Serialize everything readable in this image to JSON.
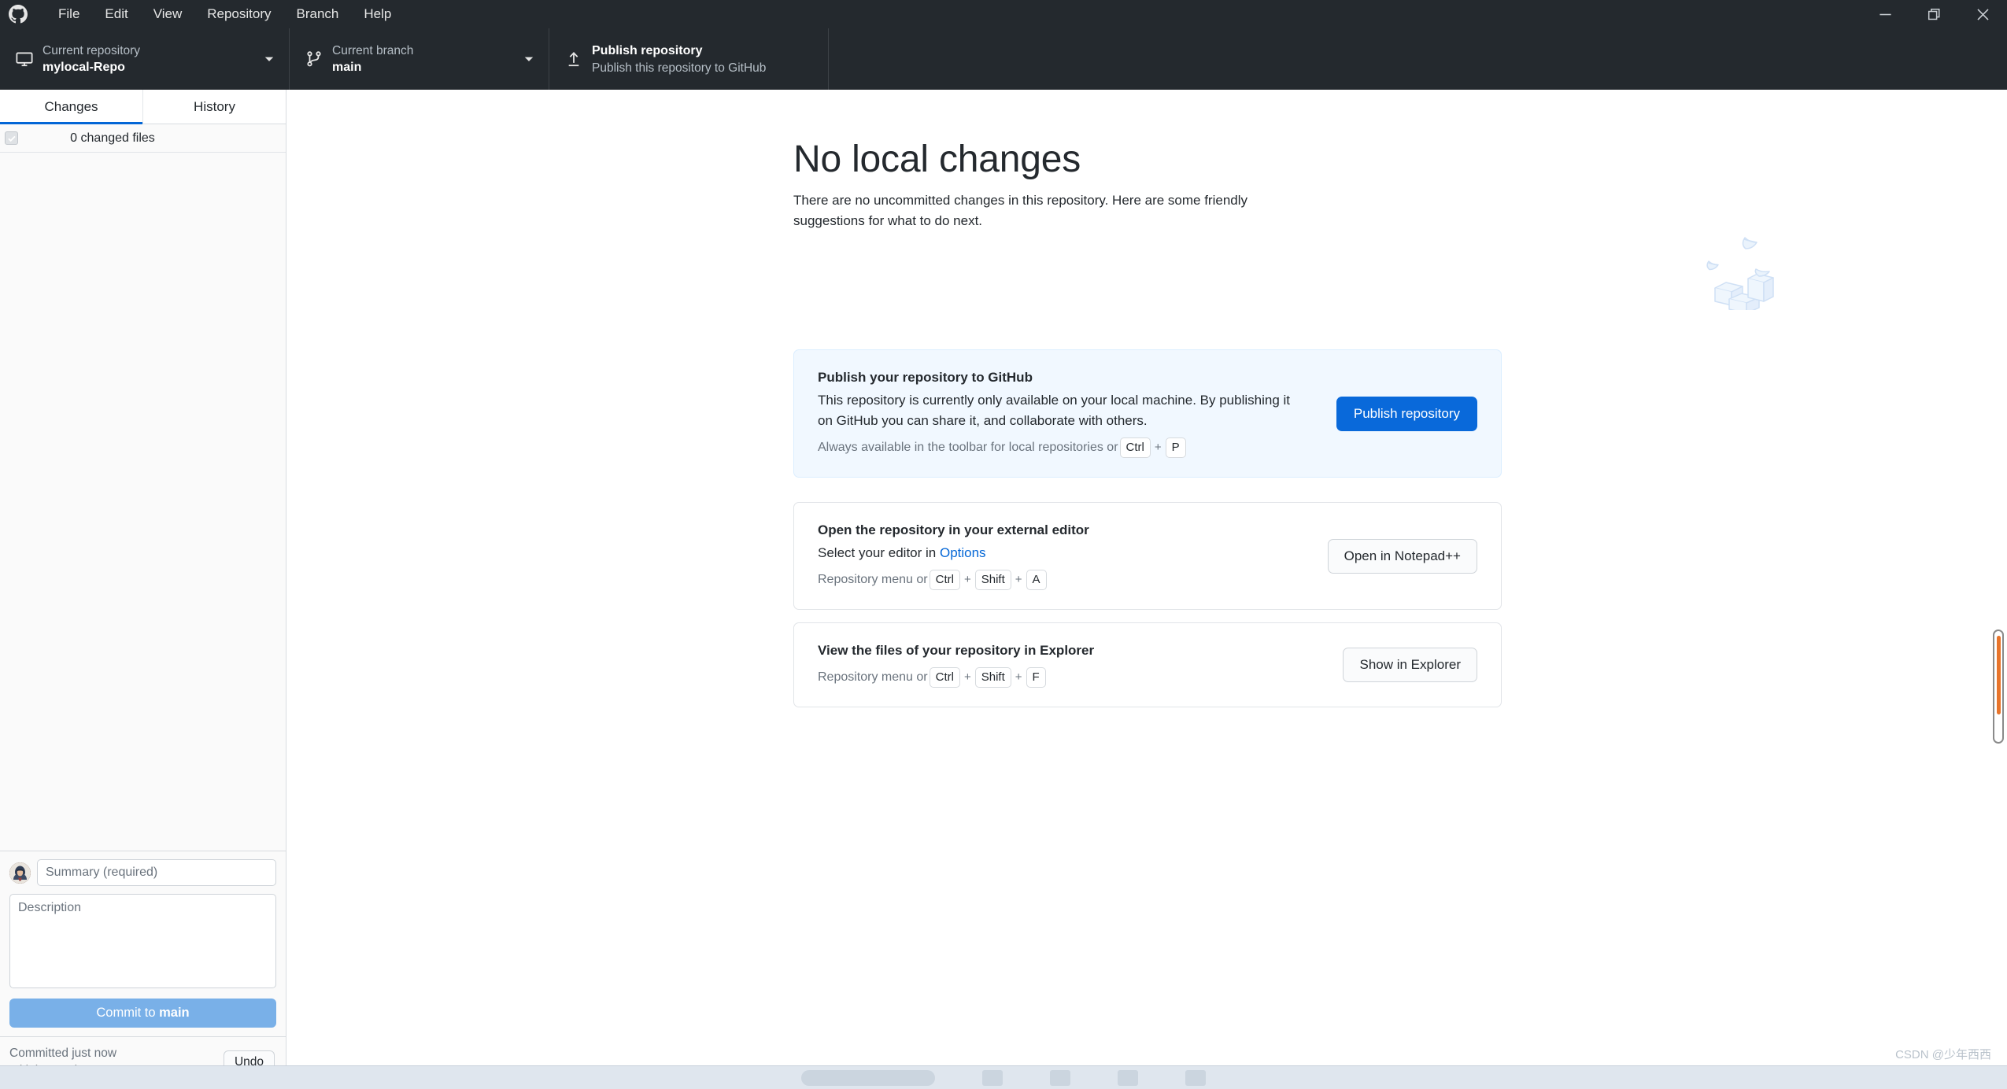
{
  "window": {
    "app_icon": "github-logo-icon",
    "minimize_label": "Minimize",
    "maximize_label": "Restore",
    "close_label": "Close"
  },
  "menubar": {
    "items": [
      {
        "label": "File"
      },
      {
        "label": "Edit"
      },
      {
        "label": "View"
      },
      {
        "label": "Repository"
      },
      {
        "label": "Branch"
      },
      {
        "label": "Help"
      }
    ]
  },
  "toolbar": {
    "repository": {
      "icon": "desktop-monitor-icon",
      "label": "Current repository",
      "value": "mylocal-Repo",
      "caret": "chevron-down-icon"
    },
    "branch": {
      "icon": "git-branch-icon",
      "label": "Current branch",
      "value": "main",
      "caret": "chevron-down-icon"
    },
    "publish": {
      "icon": "upload-arrow-icon",
      "title": "Publish repository",
      "subtitle": "Publish this repository to GitHub"
    }
  },
  "sidebar": {
    "tabs": [
      {
        "label": "Changes",
        "active": true
      },
      {
        "label": "History",
        "active": false
      }
    ],
    "changed_files": {
      "checkbox_state": "checked-disabled",
      "label": "0 changed files"
    },
    "commit": {
      "avatar": "user-avatar",
      "summary_placeholder": "Summary (required)",
      "summary_value": "",
      "description_placeholder": "Description",
      "description_value": "",
      "commit_button_prefix": "Commit to ",
      "commit_button_branch": "main"
    },
    "undo": {
      "status": "Committed just now",
      "commit_message": "Initial commit",
      "button_label": "Undo"
    }
  },
  "main": {
    "title": "No local changes",
    "description": "There are no uncommitted changes in this repository. Here are some friendly suggestions for what to do next.",
    "illustration": "paper-boats-and-boxes-illustration",
    "cards": [
      {
        "highlight": true,
        "title": "Publish your repository to GitHub",
        "description": "This repository is currently only available on your local machine. By publishing it on GitHub you can share it, and collaborate with others.",
        "hint_prefix": "Always available in the toolbar for local repositories or ",
        "keys": [
          "Ctrl",
          "P"
        ],
        "button_label": "Publish repository",
        "button_style": "primary"
      },
      {
        "highlight": false,
        "title": "Open the repository in your external editor",
        "description_prefix": "Select your editor in ",
        "description_link": "Options",
        "hint_prefix": "Repository menu or ",
        "keys": [
          "Ctrl",
          "Shift",
          "A"
        ],
        "button_label": "Open in Notepad++",
        "button_style": "default"
      },
      {
        "highlight": false,
        "title": "View the files of your repository in Explorer",
        "hint_prefix": "Repository menu or ",
        "keys": [
          "Ctrl",
          "Shift",
          "F"
        ],
        "button_label": "Show in Explorer",
        "button_style": "default"
      }
    ]
  },
  "scrollbar": {
    "orientation": "vertical",
    "thumb_color": "#e8742b"
  },
  "watermark": {
    "text": "CSDN @少年西西"
  },
  "colors": {
    "titlebar_bg": "#24292e",
    "accent_blue": "#0969da",
    "tab_active_underline": "#0366d6",
    "card_highlight_bg": "#f1f8ff",
    "commit_button_bg": "#79b0e8"
  }
}
